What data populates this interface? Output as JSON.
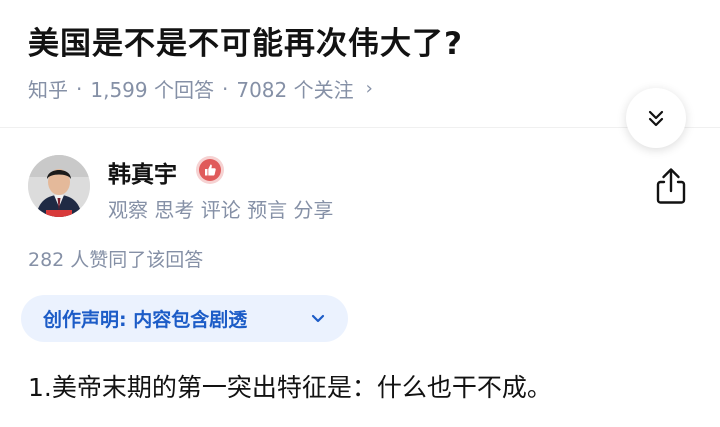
{
  "question": {
    "title": "美国是不是不可能再次伟大了?",
    "source": "知乎",
    "answers": "1,599 个回答",
    "followers": "7082 个关注",
    "separator": "·",
    "more_chevron": "›"
  },
  "author": {
    "name": "韩真宇",
    "badge_icon": "thumbs-up-badge-icon",
    "bio": "观察 思考 评论 预言 分享"
  },
  "answer": {
    "voters": "282 人赞同了该回答",
    "declaration": "创作声明: 内容包含剧透",
    "first_line": "1.美帝末期的第一突出特征是：什么也干不成。"
  },
  "colors": {
    "accent": "#1c5cc7",
    "pill_bg": "#ebf2fe",
    "muted": "#8590a6",
    "badge": "#e05a5a"
  }
}
